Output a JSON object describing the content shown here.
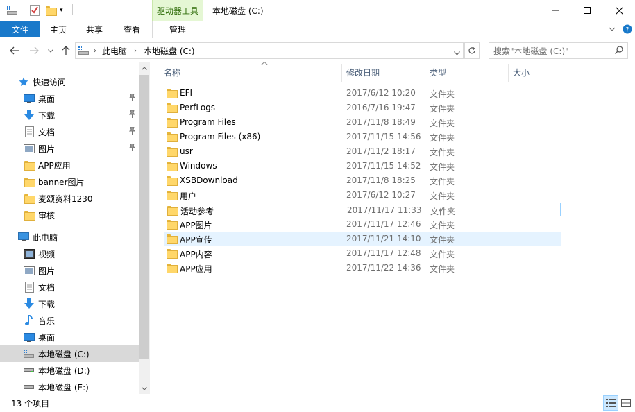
{
  "window": {
    "title": "本地磁盘 (C:)",
    "context_tab": "驱动器工具"
  },
  "ribbon": {
    "tabs": [
      "文件",
      "主页",
      "共享",
      "查看"
    ],
    "manage_tab": "管理"
  },
  "address": {
    "crumbs": [
      "此电脑",
      "本地磁盘 (C:)"
    ],
    "search_placeholder": "搜索\"本地磁盘 (C:)\""
  },
  "nav": {
    "quick_access": "快速访问",
    "quick_items": [
      {
        "label": "桌面",
        "icon": "desktop-icon",
        "pinned": true
      },
      {
        "label": "下载",
        "icon": "download-icon",
        "pinned": true
      },
      {
        "label": "文档",
        "icon": "document-icon",
        "pinned": true
      },
      {
        "label": "图片",
        "icon": "picture-icon",
        "pinned": true
      },
      {
        "label": "APP应用",
        "icon": "folder-icon",
        "pinned": false
      },
      {
        "label": "banner图片",
        "icon": "folder-icon",
        "pinned": false
      },
      {
        "label": "麦颂资料1230",
        "icon": "folder-icon",
        "pinned": false
      },
      {
        "label": "审核",
        "icon": "folder-icon",
        "pinned": false
      }
    ],
    "this_pc": "此电脑",
    "pc_items": [
      {
        "label": "视频",
        "icon": "video-icon"
      },
      {
        "label": "图片",
        "icon": "picture-icon"
      },
      {
        "label": "文档",
        "icon": "document-icon"
      },
      {
        "label": "下载",
        "icon": "download-icon"
      },
      {
        "label": "音乐",
        "icon": "music-icon"
      },
      {
        "label": "桌面",
        "icon": "desktop-icon"
      },
      {
        "label": "本地磁盘 (C:)",
        "icon": "drive-c-icon"
      },
      {
        "label": "本地磁盘 (D:)",
        "icon": "drive-icon"
      },
      {
        "label": "本地磁盘 (E:)",
        "icon": "drive-icon"
      }
    ]
  },
  "columns": {
    "name": "名称",
    "date": "修改日期",
    "type": "类型",
    "size": "大小"
  },
  "files": [
    {
      "name": "EFI",
      "date": "2017/6/12 10:20",
      "type": "文件夹"
    },
    {
      "name": "PerfLogs",
      "date": "2016/7/16 19:47",
      "type": "文件夹"
    },
    {
      "name": "Program Files",
      "date": "2017/11/8 18:49",
      "type": "文件夹"
    },
    {
      "name": "Program Files (x86)",
      "date": "2017/11/15 14:56",
      "type": "文件夹"
    },
    {
      "name": "usr",
      "date": "2017/11/2 18:17",
      "type": "文件夹"
    },
    {
      "name": "Windows",
      "date": "2017/11/15 14:52",
      "type": "文件夹"
    },
    {
      "name": "XSBDownload",
      "date": "2017/11/8 18:25",
      "type": "文件夹"
    },
    {
      "name": "用户",
      "date": "2017/6/12 10:27",
      "type": "文件夹"
    },
    {
      "name": "活动参考",
      "date": "2017/11/17 11:33",
      "type": "文件夹"
    },
    {
      "name": "APP图片",
      "date": "2017/11/17 12:46",
      "type": "文件夹"
    },
    {
      "name": "APP宣传",
      "date": "2017/11/21 14:10",
      "type": "文件夹"
    },
    {
      "name": "APP内容",
      "date": "2017/11/17 12:48",
      "type": "文件夹"
    },
    {
      "name": "APP应用",
      "date": "2017/11/22 14:36",
      "type": "文件夹"
    }
  ],
  "status": {
    "item_count": "13 个项目"
  }
}
